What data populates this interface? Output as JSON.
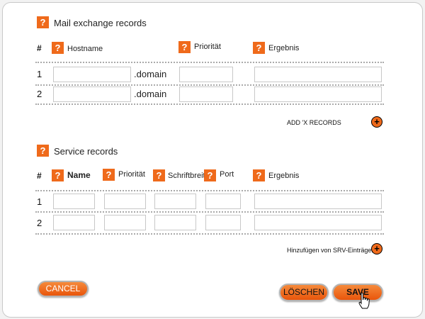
{
  "mx": {
    "heading": "Mail exchange records",
    "hash": "#",
    "cols": {
      "hostname": "Hostname",
      "priority": "Priorität",
      "result": "Ergebnis"
    },
    "rows": [
      {
        "num": "1",
        "suffix": ".domain"
      },
      {
        "num": "2",
        "suffix": ".domain"
      }
    ],
    "add_label": "ADD 'X RECORDS"
  },
  "srv": {
    "heading": "Service records",
    "hash": "#",
    "cols": {
      "name": "Name",
      "priority": "Priorität",
      "weight": "Schriftbreite",
      "port": "Port",
      "result": "Ergebnis"
    },
    "rows": [
      {
        "num": "1"
      },
      {
        "num": "2"
      }
    ],
    "add_label": "Hinzufügen von SRV-Einträgen"
  },
  "buttons": {
    "cancel": "CANCEL",
    "delete": "LÖSCHEN",
    "save": "SAVE"
  },
  "help_icon_glyph": "?",
  "plus_glyph": "+",
  "colors": {
    "accent": "#ef6a1b",
    "panel": "#ffffff",
    "background": "#f2f2f2"
  }
}
